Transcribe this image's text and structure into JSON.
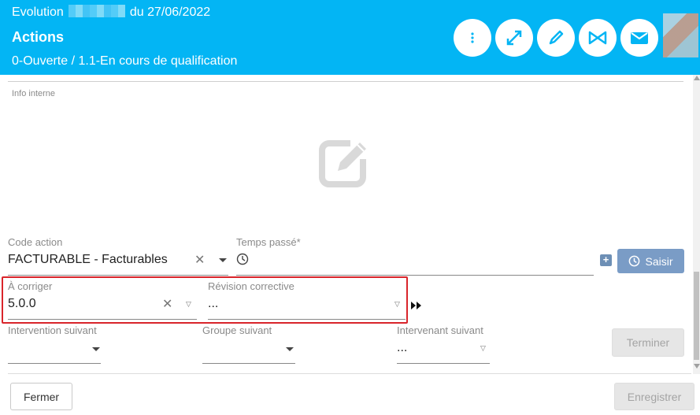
{
  "header": {
    "title_prefix": "Evolution",
    "title_suffix": "du 27/06/2022",
    "subtitle": "Actions",
    "status": "0-Ouverte / 1.1-En cours de qualification",
    "buttons": [
      "more-vertical-icon",
      "expand-icon",
      "pen-icon",
      "bowtie-icon",
      "envelope-icon"
    ],
    "accent_color": "#03b5f4"
  },
  "form": {
    "info_interne": {
      "label": "Info interne"
    },
    "code_action": {
      "label": "Code action",
      "value": "FACTURABLE - Facturables"
    },
    "temps_passe": {
      "label": "Temps passé*",
      "value": ""
    },
    "saisir_label": "Saisir",
    "plus_label": "+",
    "a_corriger": {
      "label": "À corriger",
      "value": "5.0.0"
    },
    "revision_corrective": {
      "label": "Révision corrective",
      "value": "..."
    },
    "intervention_suivant": {
      "label": "Intervention suivant",
      "value": ""
    },
    "groupe_suivant": {
      "label": "Groupe suivant",
      "value": ""
    },
    "intervenant_suivant": {
      "label": "Intervenant suivant",
      "value": "..."
    },
    "terminer_label": "Terminer"
  },
  "footer": {
    "fermer_label": "Fermer",
    "enregistrer_label": "Enregistrer"
  }
}
